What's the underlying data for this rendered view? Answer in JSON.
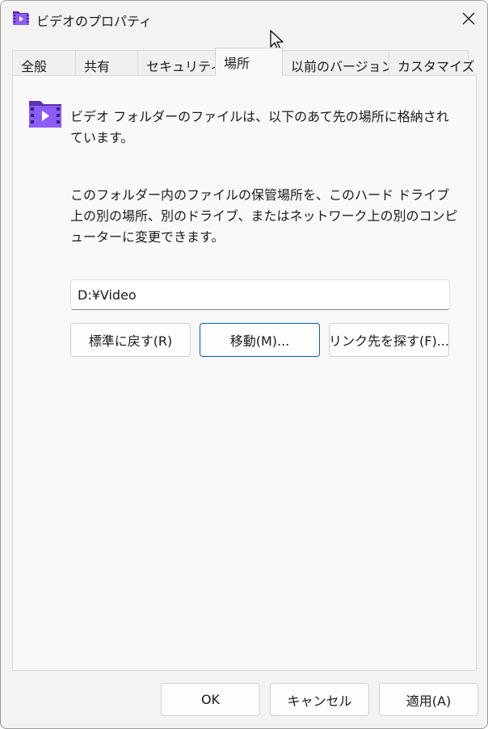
{
  "window": {
    "title": "ビデオのプロパティ"
  },
  "tabs": [
    {
      "label": "全般"
    },
    {
      "label": "共有"
    },
    {
      "label": "セキュリティ"
    },
    {
      "label": "場所"
    },
    {
      "label": "以前のバージョン"
    },
    {
      "label": "カスタマイズ"
    }
  ],
  "active_tab": "場所",
  "location": {
    "description1": "ビデオ フォルダーのファイルは、以下のあて先の場所に格納されています。",
    "description2": "このフォルダー内のファイルの保管場所を、このハード ドライブ上の別の場所、別のドライブ、またはネットワーク上の別のコンピューターに変更できます。",
    "path_value": "D:¥Video",
    "restore_default_label": "標準に戻す(R)",
    "move_label": "移動(M)...",
    "find_target_label": "リンク先を探す(F)..."
  },
  "footer": {
    "ok_label": "OK",
    "cancel_label": "キャンセル",
    "apply_label": "適用(A)"
  },
  "colors": {
    "accent": "#005fb8",
    "folder_purple": "#7b4fd6"
  },
  "icons": {
    "title": "video-folder-icon",
    "close": "close-icon",
    "location": "video-folder-icon"
  }
}
